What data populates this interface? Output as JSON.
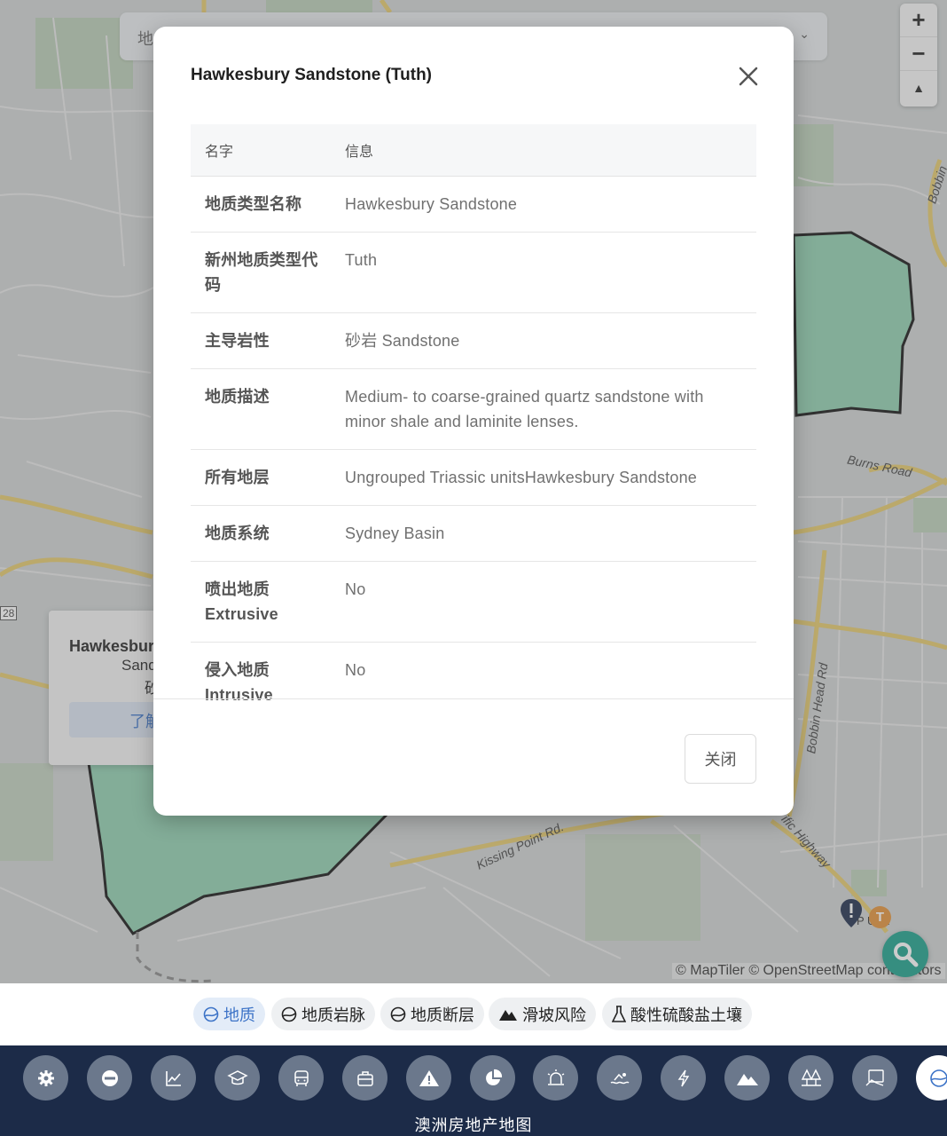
{
  "map": {
    "search_placeholder": "地",
    "zoom_in": "+",
    "zoom_out": "−",
    "compass": "▲",
    "road_labels": {
      "burns_road": "Burns Road",
      "bobbin_head_rd": "Bobbin Head Rd",
      "kissing_point_rd": "Kissing Point Rd.",
      "pacific_highway": "ific Highway",
      "bobbin_right": "Bobbin",
      "route_a28": "28",
      "poi_label": "P ULE"
    },
    "popup": {
      "title": "Hawkesbur",
      "line2": "Sand",
      "line3": "砂",
      "button": "了解"
    },
    "attribution": "© MapTiler © OpenStreetMap contributors",
    "marker_t_label": "T",
    "colors": {
      "geology_fill": "#8fcfb0",
      "search_fab": "#1aa08a"
    }
  },
  "modal": {
    "title": "Hawkesbury Sandstone (Tuth)",
    "header_name": "名字",
    "header_info": "信息",
    "rows": [
      {
        "key": "地质类型名称",
        "value": "Hawkesbury Sandstone"
      },
      {
        "key": "新州地质类型代码",
        "value": "Tuth"
      },
      {
        "key": "主导岩性",
        "value": "砂岩 Sandstone"
      },
      {
        "key": "地质描述",
        "value": "Medium- to coarse-grained quartz sandstone with minor shale and laminite lenses."
      },
      {
        "key": "所有地层",
        "value": "Ungrouped Triassic unitsHawkesbury Sandstone"
      },
      {
        "key": "地质系统",
        "value": "Sydney Basin"
      },
      {
        "key": "喷出地质 Extrusive",
        "value": "No"
      },
      {
        "key": "侵入地质 Intrusive",
        "value": "No"
      }
    ],
    "footer_close": "关闭"
  },
  "layer_tabs": [
    {
      "label": "地质",
      "icon": "geology-icon",
      "active": true
    },
    {
      "label": "地质岩脉",
      "icon": "geology-dyke-icon",
      "active": false
    },
    {
      "label": "地质断层",
      "icon": "geology-fault-icon",
      "active": false
    },
    {
      "label": "滑坡风险",
      "icon": "mountain-icon",
      "active": false
    },
    {
      "label": "酸性硫酸盐土壤",
      "icon": "flask-icon",
      "active": false
    }
  ],
  "bottom_nav": {
    "title": "澳洲房地产地图",
    "buttons": [
      "settings-icon",
      "minus-circle-icon",
      "chart-icon",
      "graduation-cap-icon",
      "bus-icon",
      "briefcase-icon",
      "warning-icon",
      "pie-chart-icon",
      "alarm-light-icon",
      "swimmer-icon",
      "lightning-icon",
      "mountain-icon",
      "trees-icon",
      "map-board-icon",
      "geology-icon"
    ],
    "active_button": "geology-icon"
  }
}
